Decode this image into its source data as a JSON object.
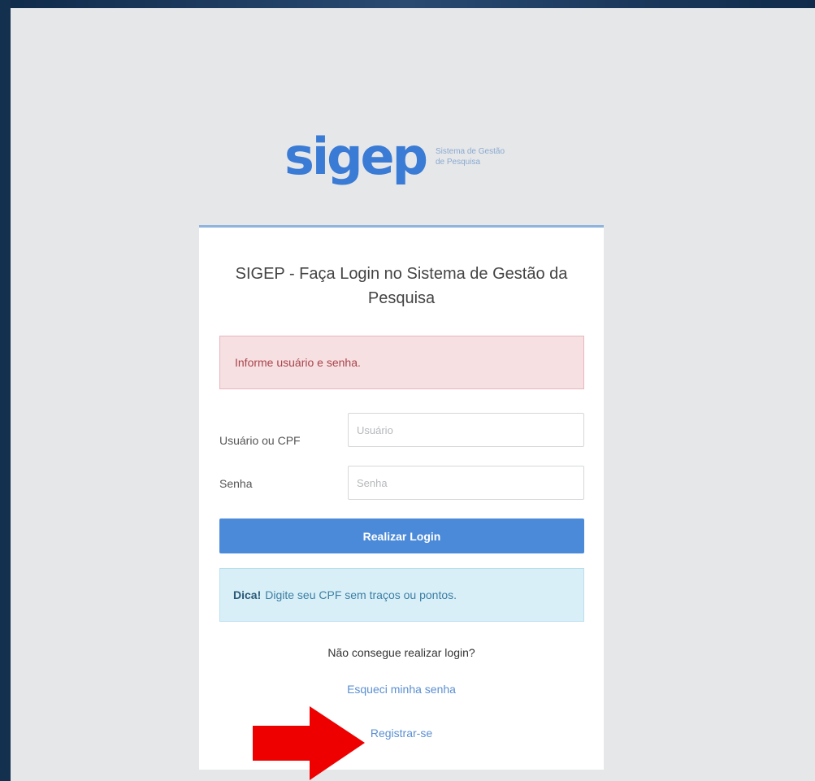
{
  "logo": {
    "word": "sigep",
    "subtitle_line1": "Sistema de Gestão",
    "subtitle_line2": "de Pesquisa"
  },
  "login": {
    "title": "SIGEP - Faça Login no Sistema de Gestão da Pesquisa",
    "error_message": "Informe usuário e senha.",
    "username_label": "Usuário ou CPF",
    "username_placeholder": "Usuário",
    "password_label": "Senha",
    "password_placeholder": "Senha",
    "submit_label": "Realizar Login",
    "tip_bold": "Dica!",
    "tip_text": "Digite seu CPF sem traços ou pontos.",
    "help_text": "Não consegue realizar login?",
    "forgot_link": "Esqueci minha senha",
    "register_link": "Registrar-se"
  },
  "colors": {
    "accent": "#4a8ad8",
    "annotation_arrow": "#ee0000"
  }
}
